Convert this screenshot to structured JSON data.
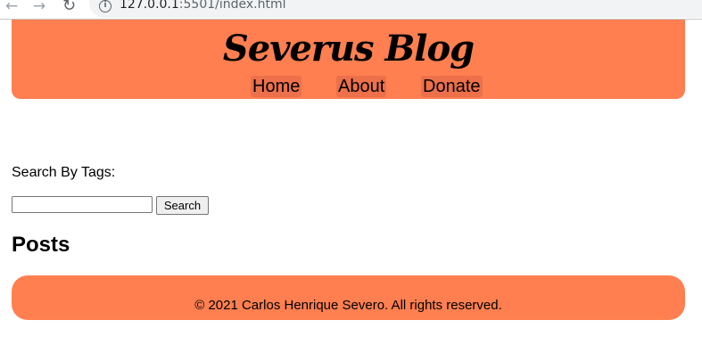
{
  "browser": {
    "back_icon": "←",
    "forward_icon": "→",
    "reload_icon": "↻",
    "info_icon": "i",
    "url_host": "127.0.0.1",
    "url_rest": ":5501/index.html"
  },
  "header": {
    "title": "Severus Blog",
    "nav": [
      {
        "label": "Home"
      },
      {
        "label": "About"
      },
      {
        "label": "Donate"
      }
    ],
    "background_color": "#ff7f50"
  },
  "search": {
    "label": "Search By Tags:",
    "input_value": "",
    "button_label": "Search"
  },
  "posts": {
    "heading": "Posts"
  },
  "footer": {
    "text": "© 2021 Carlos Henrique Severo. All rights reserved."
  }
}
